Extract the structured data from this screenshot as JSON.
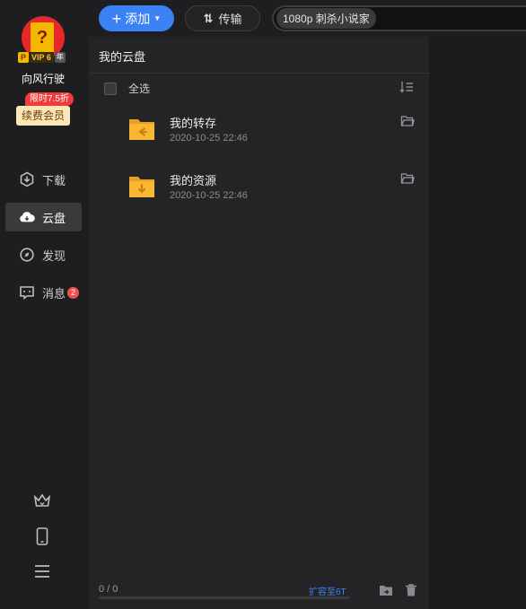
{
  "profile": {
    "vip_label": "VIP 6",
    "vip_p": "P",
    "vip_year": "年",
    "username": "向风行驶",
    "promo": "限时7.5折",
    "renew_label": "续费会员"
  },
  "nav": {
    "download": "下载",
    "cloud": "云盘",
    "discover": "发现",
    "messages": "消息",
    "messages_badge": "2"
  },
  "toolbar": {
    "add_label": "添加",
    "transfer_label": "传输",
    "search_chip": "1080p 刺杀小说家"
  },
  "main": {
    "title": "我的云盘",
    "select_all": "全选",
    "files": [
      {
        "name": "我的转存",
        "date": "2020-10-25 22:46"
      },
      {
        "name": "我的资源",
        "date": "2020-10-25 22:46"
      }
    ],
    "footer": {
      "count": "0 / 0",
      "expand": "扩容至6T",
      "storage_used_fraction": 0
    }
  },
  "colors": {
    "accent": "#3b82f6",
    "folder": "#f7b733",
    "badge": "#f24f4f"
  }
}
